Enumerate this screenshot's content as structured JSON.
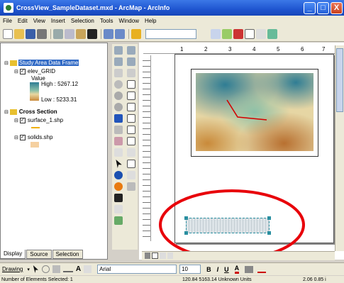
{
  "window": {
    "title": "CrossView_SampleDataset.mxd - ArcMap - ArcInfo",
    "min_label": "_",
    "max_label": "□",
    "close_label": "X"
  },
  "menu": [
    "File",
    "Edit",
    "View",
    "Insert",
    "Selection",
    "Tools",
    "Window",
    "Help"
  ],
  "toc": {
    "data_frame": "Study Area Data Frame",
    "layer_grid": "elev_GRID",
    "value_label": "Value",
    "high_label": "High : 5267.12",
    "low_label": "Low : 5233.31",
    "group": "Cross Section",
    "layer_surface": "surface_1.shp",
    "layer_solids": "solids.shp",
    "tabs": [
      "Display",
      "Source",
      "Selection"
    ]
  },
  "ruler_ticks": [
    "1",
    "2",
    "3",
    "4",
    "5",
    "6",
    "7"
  ],
  "drawing": {
    "label": "Drawing",
    "font": "Arial",
    "size": "10",
    "bold": "B",
    "italic": "I",
    "underline": "U",
    "font_color": "A"
  },
  "status": {
    "selected": "Number of Elements Selected: 1",
    "coords": "120.84  5163.14 Unknown Units",
    "page_coords": "2.06  0.85 i"
  },
  "colors": {
    "annotation_ellipse": "#e8000a",
    "cross_section_line": "#d40000",
    "title_bar": "#1f55d0",
    "high_ramp": "#2f7d94",
    "low_ramp": "#c98a3a"
  }
}
